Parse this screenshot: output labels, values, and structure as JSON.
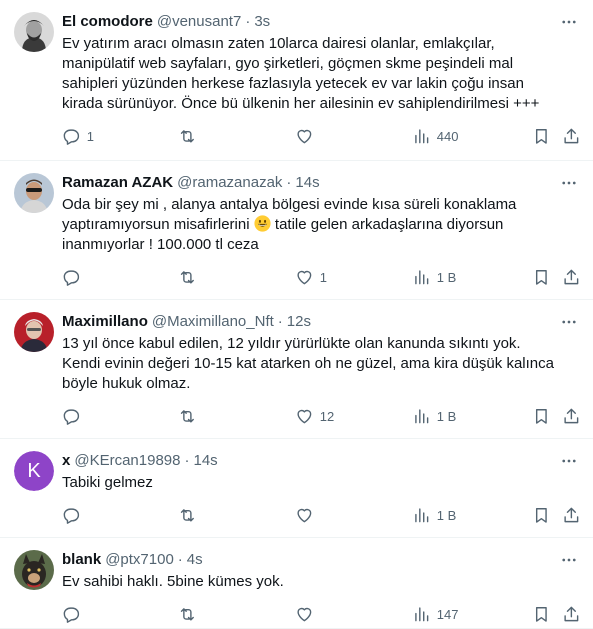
{
  "tweets": [
    {
      "name": "El comodore",
      "handle": "@venusant7",
      "time": "3s",
      "text": "Ev yatırım aracı olmasın zaten 10larca dairesi olanlar, emlakçılar, manipülatif web sayfaları, gyo şirketleri, göçmen skme peşindeli mal sahipleri yüzünden herkese fazlasıyla yetecek ev var lakin çoğu insan kirada sürünüyor. Önce bü ülkenin her ailesinin ev sahiplendirilmesi +++",
      "replies": "1",
      "retweets": "",
      "likes": "",
      "views": "440",
      "avatar": "bw-portrait"
    },
    {
      "name": "Ramazan AZAK",
      "handle": "@ramazanazak",
      "time": "14s",
      "text_a": "Oda bir şey mi , alanya antalya bölgesi evinde kısa süreli konaklama yaptıramıyorsun misafirlerini",
      "text_b": "tatile gelen arkadaşlarına diyorsun inanmıyorlar ! 100.000 tl  ceza",
      "emoji": "grinning-face-emoji",
      "replies": "",
      "retweets": "",
      "likes": "1",
      "views": "1 B",
      "avatar": "man-sunglasses"
    },
    {
      "name": "Maximillano",
      "handle": "@Maximillano_Nft",
      "time": "12s",
      "text": "13 yıl önce kabul edilen, 12 yıldır yürürlükte olan kanunda sıkıntı yok. Kendi evinin değeri 10-15 kat atarken oh ne güzel, ama kira düşük kalınca böyle hukuk olmaz.",
      "replies": "",
      "retweets": "",
      "likes": "12",
      "views": "1 B",
      "avatar": "man-red-bg"
    },
    {
      "name": "x",
      "handle": "@KErcan19898",
      "time": "14s",
      "text": "Tabiki gelmez",
      "replies": "",
      "retweets": "",
      "likes": "",
      "views": "1 B",
      "avatar_letter": "K",
      "avatar_color": "#8e44c8"
    },
    {
      "name": "blank",
      "handle": "@ptx7100",
      "time": "4s",
      "text": "Ev sahibi haklı. 5bine kümes yok.",
      "replies": "",
      "retweets": "",
      "likes": "",
      "views": "147",
      "avatar": "dog"
    }
  ],
  "sep": "·",
  "colors": {
    "text": "#0f1419",
    "muted": "#536471",
    "border": "#eff3f4"
  }
}
